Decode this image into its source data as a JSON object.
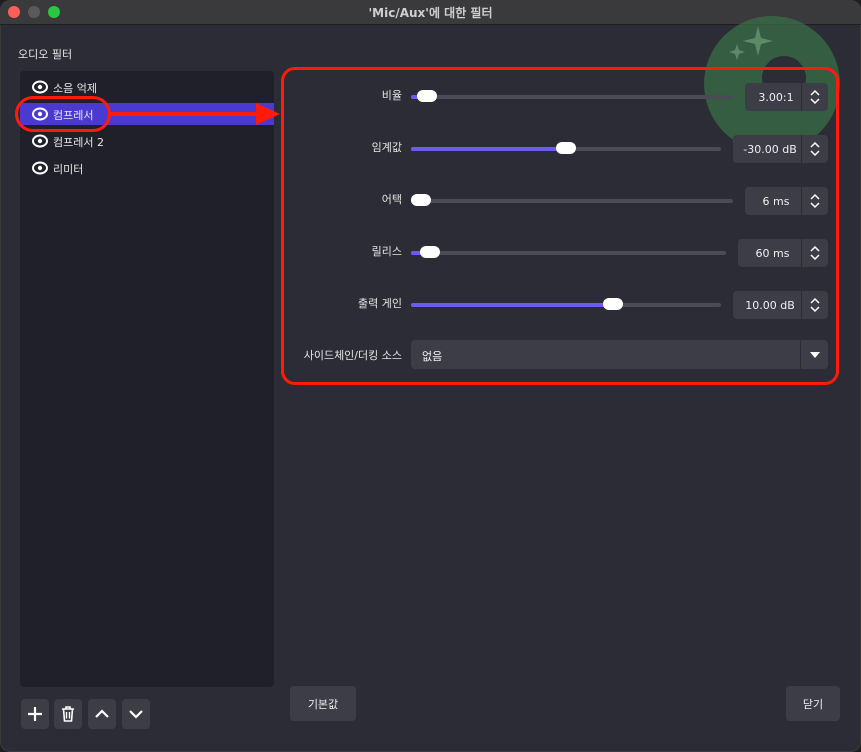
{
  "window": {
    "title": "'Mic/Aux'에 대한 필터"
  },
  "filters_panel": {
    "section_label": "오디오 필터",
    "items": [
      {
        "label": "소음 억제",
        "selected": false
      },
      {
        "label": "컴프레서",
        "selected": true
      },
      {
        "label": "컴프레서 2",
        "selected": false
      },
      {
        "label": "리미터",
        "selected": false
      }
    ],
    "buttons": [
      "plus-icon",
      "trash-icon",
      "chevron-up-icon",
      "chevron-down-icon"
    ]
  },
  "properties": {
    "ratio": {
      "label": "비율",
      "value": "3.00:1",
      "fraction": 0.05
    },
    "threshold": {
      "label": "임계값",
      "value": "-30.00 dB",
      "fraction": 0.5
    },
    "attack": {
      "label": "어택",
      "value": "6 ms",
      "fraction": 0.01
    },
    "release": {
      "label": "릴리스",
      "value": "60 ms",
      "fraction": 0.06
    },
    "output_gain": {
      "label": "출력 게인",
      "value": "10.00 dB",
      "fraction": 0.65
    },
    "sidechain": {
      "label": "사이드체인/더킹 소스",
      "value": "없음"
    }
  },
  "footer": {
    "defaults_label": "기본값",
    "close_label": "닫기"
  },
  "colors": {
    "accent": "#6a5cf0",
    "selection": "#4a3ad0",
    "annotation": "#ff1a0a"
  }
}
